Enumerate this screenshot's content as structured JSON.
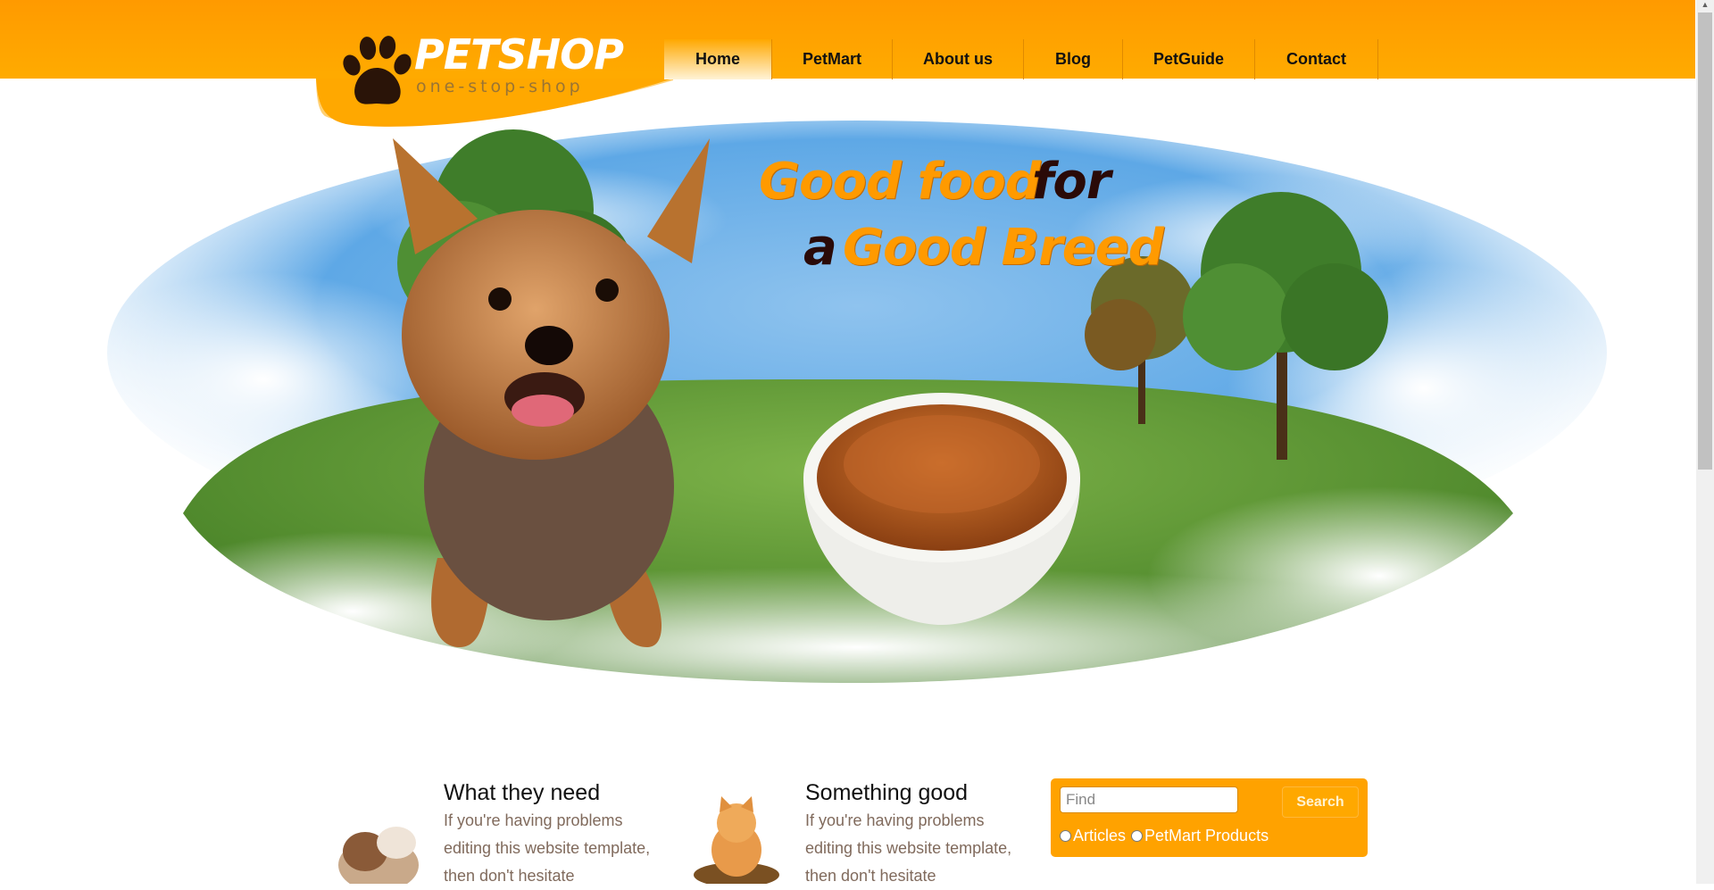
{
  "brand": {
    "title": "PETSHOP",
    "tagline": "one-stop-shop"
  },
  "nav": {
    "items": [
      {
        "label": "Home",
        "active": true
      },
      {
        "label": "PetMart",
        "active": false
      },
      {
        "label": "About us",
        "active": false
      },
      {
        "label": "Blog",
        "active": false
      },
      {
        "label": "PetGuide",
        "active": false
      },
      {
        "label": "Contact",
        "active": false
      }
    ]
  },
  "hero": {
    "line1_orange": "Good food",
    "line1_dark": "for",
    "line2_dark": "a",
    "line2_orange": "Good Breed"
  },
  "columns": [
    {
      "heading": "What they need",
      "text": "If you're having problems editing this website template, then don't hesitate"
    },
    {
      "heading": "Something good",
      "text": "If you're having problems editing this website template, then don't hesitate"
    }
  ],
  "search": {
    "placeholder": "Find",
    "button_label": "Search",
    "options": [
      "Articles",
      "PetMart Products"
    ]
  },
  "colors": {
    "header": "#ff9a00",
    "accent": "#ffa200",
    "body_text": "#806a5c"
  }
}
